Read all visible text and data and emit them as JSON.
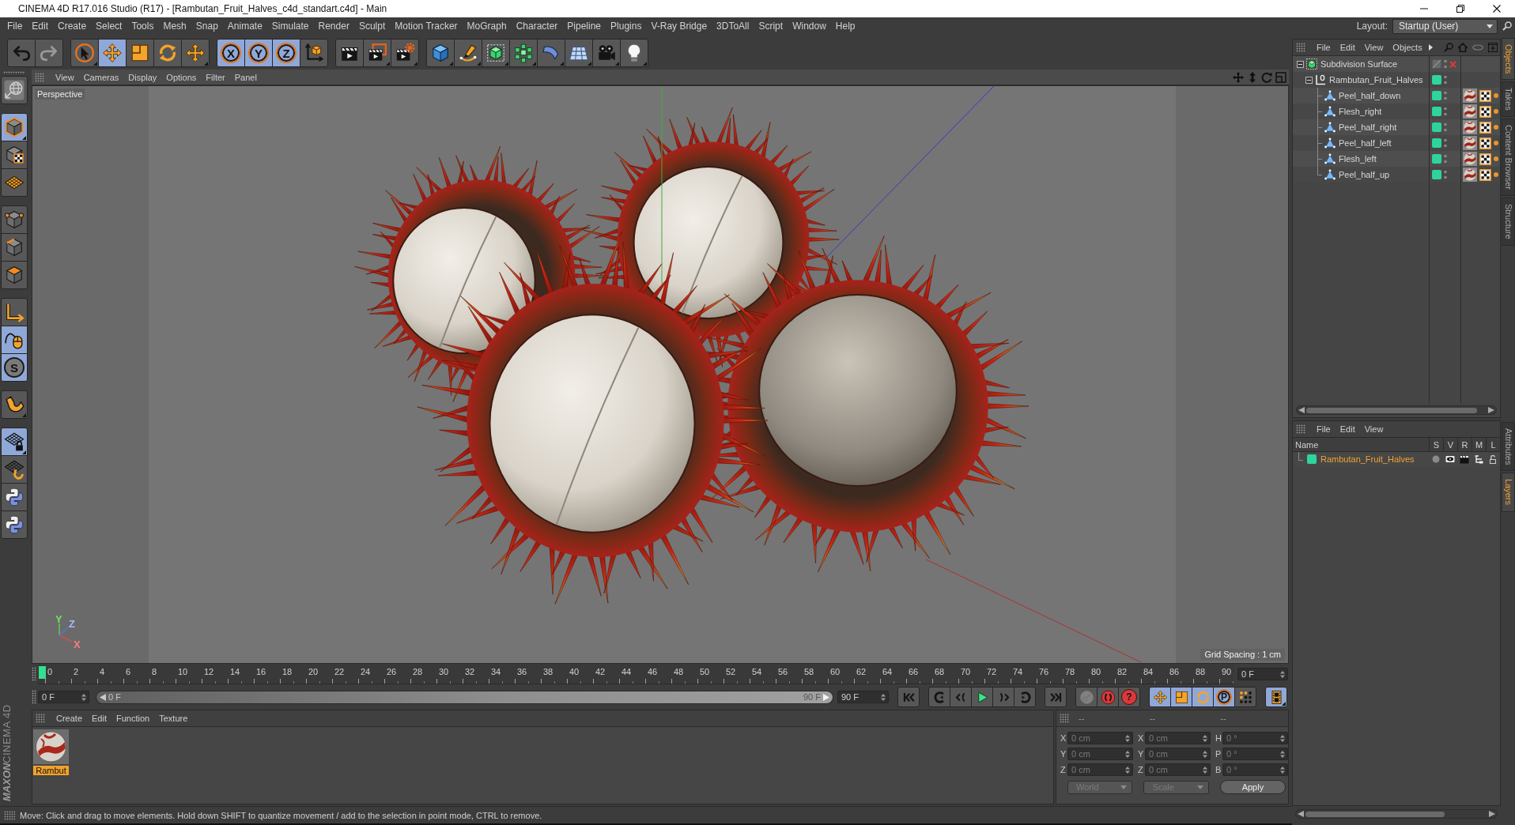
{
  "window": {
    "title": "CINEMA 4D R17.016 Studio (R17) - [Rambutan_Fruit_Halves_c4d_standart.c4d] - Main"
  },
  "menu_bar": {
    "items": [
      "File",
      "Edit",
      "Create",
      "Select",
      "Tools",
      "Mesh",
      "Snap",
      "Animate",
      "Simulate",
      "Render",
      "Sculpt",
      "Motion Tracker",
      "MoGraph",
      "Character",
      "Pipeline",
      "Plugins",
      "V-Ray Bridge",
      "3DToAll",
      "Script",
      "Window",
      "Help"
    ],
    "layout_label": "Layout:",
    "layout_value": "Startup (User)"
  },
  "toolbar": {
    "groups": [
      {
        "items": [
          {
            "kind": "undo",
            "disabled": false
          },
          {
            "kind": "redo",
            "disabled": true
          }
        ]
      },
      {
        "items": [
          {
            "kind": "select",
            "selected": false
          },
          {
            "kind": "move",
            "selected": true
          },
          {
            "kind": "scale",
            "selected": false
          },
          {
            "kind": "rotate",
            "selected": false
          },
          {
            "kind": "recent",
            "selected": false
          }
        ]
      },
      {
        "items": [
          {
            "kind": "letter",
            "label": "X",
            "on": true
          },
          {
            "kind": "letter",
            "label": "Y",
            "on": true
          },
          {
            "kind": "letter",
            "label": "Z",
            "on": true
          },
          {
            "kind": "coordinates",
            "on": false
          }
        ]
      },
      {
        "items": [
          {
            "kind": "render-view"
          },
          {
            "kind": "render-picture"
          },
          {
            "kind": "render-settings"
          }
        ]
      },
      {
        "items": [
          {
            "kind": "cube"
          },
          {
            "kind": "pen"
          },
          {
            "kind": "subdivision"
          },
          {
            "kind": "cloner"
          },
          {
            "kind": "bend"
          },
          {
            "kind": "floor"
          },
          {
            "kind": "camera"
          },
          {
            "kind": "light"
          }
        ]
      }
    ]
  },
  "left_toolbar": {
    "groups": [
      {
        "items": [
          {
            "kind": "make-editable"
          }
        ]
      },
      {
        "items": [
          {
            "kind": "model",
            "selected": true
          },
          {
            "kind": "texture",
            "selected": false
          },
          {
            "kind": "workplane",
            "selected": false
          }
        ]
      },
      {
        "items": [
          {
            "kind": "points",
            "selected": false
          },
          {
            "kind": "edges",
            "selected": false
          },
          {
            "kind": "polygons",
            "selected": false
          }
        ]
      },
      {
        "items": [
          {
            "kind": "axis",
            "on": false
          },
          {
            "kind": "tweak",
            "on": true
          },
          {
            "kind": "letter",
            "label": "S",
            "on": true
          }
        ]
      },
      {
        "items": [
          {
            "kind": "magnet"
          }
        ]
      },
      {
        "items": [
          {
            "kind": "workplane-lock",
            "on": true
          },
          {
            "kind": "workplane-align",
            "on": false
          },
          {
            "kind": "python",
            "on": false
          },
          {
            "kind": "python",
            "on": false
          }
        ]
      }
    ]
  },
  "viewport": {
    "menu": [
      "View",
      "Cameras",
      "Display",
      "Options",
      "Filter",
      "Panel"
    ],
    "camera": "Perspective",
    "axis_labels": [
      "Y",
      "Z",
      "X"
    ],
    "grid_spacing": "Grid Spacing : 1 cm"
  },
  "object_manager": {
    "menu": [
      "File",
      "Edit",
      "View",
      "Objects"
    ],
    "objects": [
      {
        "name": "Subdivision Surface",
        "kind": "subdivision",
        "enabled": false,
        "expanded": true,
        "children": [
          {
            "name": "Rambutan_Fruit_Halves",
            "kind": "null",
            "color": "#2fd49c",
            "expanded": true,
            "children": [
              {
                "name": "Peel_half_down",
                "kind": "polygon",
                "color": "#2fd49c",
                "tags": [
                  {
                    "kind": "material"
                  },
                  {
                    "kind": "uvw"
                  },
                  {
                    "kind": "dot"
                  }
                ]
              },
              {
                "name": "Flesh_right",
                "kind": "polygon",
                "color": "#2fd49c",
                "tags": [
                  {
                    "kind": "material"
                  },
                  {
                    "kind": "uvw"
                  },
                  {
                    "kind": "dot"
                  }
                ]
              },
              {
                "name": "Peel_half_right",
                "kind": "polygon",
                "color": "#2fd49c",
                "tags": [
                  {
                    "kind": "material"
                  },
                  {
                    "kind": "uvw"
                  },
                  {
                    "kind": "dot"
                  }
                ]
              },
              {
                "name": "Peel_half_left",
                "kind": "polygon",
                "color": "#2fd49c",
                "tags": [
                  {
                    "kind": "material"
                  },
                  {
                    "kind": "uvw"
                  },
                  {
                    "kind": "dot"
                  }
                ]
              },
              {
                "name": "Flesh_left",
                "kind": "polygon",
                "color": "#2fd49c",
                "tags": [
                  {
                    "kind": "material"
                  },
                  {
                    "kind": "uvw"
                  },
                  {
                    "kind": "dot"
                  }
                ]
              },
              {
                "name": "Peel_half_up",
                "kind": "polygon",
                "color": "#2fd49c",
                "tags": [
                  {
                    "kind": "material"
                  },
                  {
                    "kind": "uvw"
                  },
                  {
                    "kind": "dot"
                  }
                ]
              }
            ]
          }
        ]
      }
    ]
  },
  "side_tabs": {
    "upper": [
      {
        "label": "Objects",
        "selected": true
      },
      {
        "label": "Takes",
        "selected": false
      },
      {
        "label": "Content Browser",
        "selected": false
      },
      {
        "label": "Structure",
        "selected": false
      }
    ],
    "lower": [
      {
        "label": "Attributes",
        "selected": false
      },
      {
        "label": "Layers",
        "selected": true
      }
    ]
  },
  "timeline": {
    "ticks": [
      "0",
      "2",
      "4",
      "6",
      "8",
      "10",
      "12",
      "14",
      "16",
      "18",
      "20",
      "22",
      "24",
      "26",
      "28",
      "30",
      "32",
      "34",
      "36",
      "38",
      "40",
      "42",
      "44",
      "46",
      "48",
      "50",
      "52",
      "54",
      "56",
      "58",
      "60",
      "62",
      "64",
      "66",
      "68",
      "70",
      "72",
      "74",
      "76",
      "78",
      "80",
      "82",
      "84",
      "86",
      "88",
      "90"
    ],
    "level": 0,
    "frame_field": "0 F"
  },
  "playback": {
    "start_field": "0 F",
    "range": {
      "start": "0 F",
      "end": "90 F",
      "level": 1
    },
    "end_field": "90 F",
    "groups": [
      {
        "items": [
          {
            "kind": "go-start"
          }
        ]
      },
      {
        "items": [
          {
            "kind": "prev-key"
          },
          {
            "kind": "prev-frame"
          },
          {
            "kind": "play"
          },
          {
            "kind": "next-frame"
          },
          {
            "kind": "next-key"
          }
        ]
      },
      {
        "items": [
          {
            "kind": "go-end"
          }
        ]
      },
      {
        "items": [
          {
            "kind": "record",
            "disabled": true
          },
          {
            "kind": "autokey",
            "disabled": false
          },
          {
            "kind": "help",
            "label": "?",
            "disabled": false
          }
        ]
      },
      {
        "items": [
          {
            "kind": "move",
            "on": true
          },
          {
            "kind": "scale",
            "on": true
          },
          {
            "kind": "rotate",
            "on": true
          },
          {
            "kind": "letter",
            "label": "P",
            "on": true
          },
          {
            "kind": "points-grid",
            "on": false
          }
        ]
      },
      {
        "items": [
          {
            "kind": "timeline",
            "on": true
          }
        ]
      }
    ]
  },
  "material_manager": {
    "menu": [
      "Create",
      "Edit",
      "Function",
      "Texture"
    ],
    "materials": [
      {
        "name": "Rambut",
        "selected": true
      }
    ]
  },
  "coordinates": {
    "disabled": true,
    "headers": [
      "--",
      "--",
      "--"
    ],
    "rows": [
      {
        "cells": [
          {
            "axis": "X",
            "value": "0 cm"
          },
          {
            "axis": "X",
            "value": "0 cm"
          },
          {
            "axis": "H",
            "value": "0 °"
          }
        ]
      },
      {
        "cells": [
          {
            "axis": "Y",
            "value": "0 cm"
          },
          {
            "axis": "Y",
            "value": "0 cm"
          },
          {
            "axis": "P",
            "value": "0 °"
          }
        ]
      },
      {
        "cells": [
          {
            "axis": "Z",
            "value": "0 cm"
          },
          {
            "axis": "Z",
            "value": "0 cm"
          },
          {
            "axis": "B",
            "value": "0 °"
          }
        ]
      }
    ],
    "dropdowns": [
      "World",
      "Scale"
    ],
    "apply": "Apply"
  },
  "layer_manager": {
    "menu": [
      "File",
      "Edit",
      "View"
    ],
    "columns": [
      "Name",
      "S",
      "V",
      "R",
      "M",
      "L"
    ],
    "layers": [
      {
        "name": "Rambutan_Fruit_Halves",
        "color": "#2fd49c",
        "selected": true,
        "solo": false,
        "visible": true,
        "render": true,
        "manager": true,
        "locked": false
      }
    ]
  },
  "logo": {
    "brand": "MAXON",
    "product": "CINEMA 4D"
  },
  "status_bar": {
    "text": "Move: Click and drag to move elements. Hold down SHIFT to quantize movement / add to the selection in point mode, CTRL to remove."
  }
}
